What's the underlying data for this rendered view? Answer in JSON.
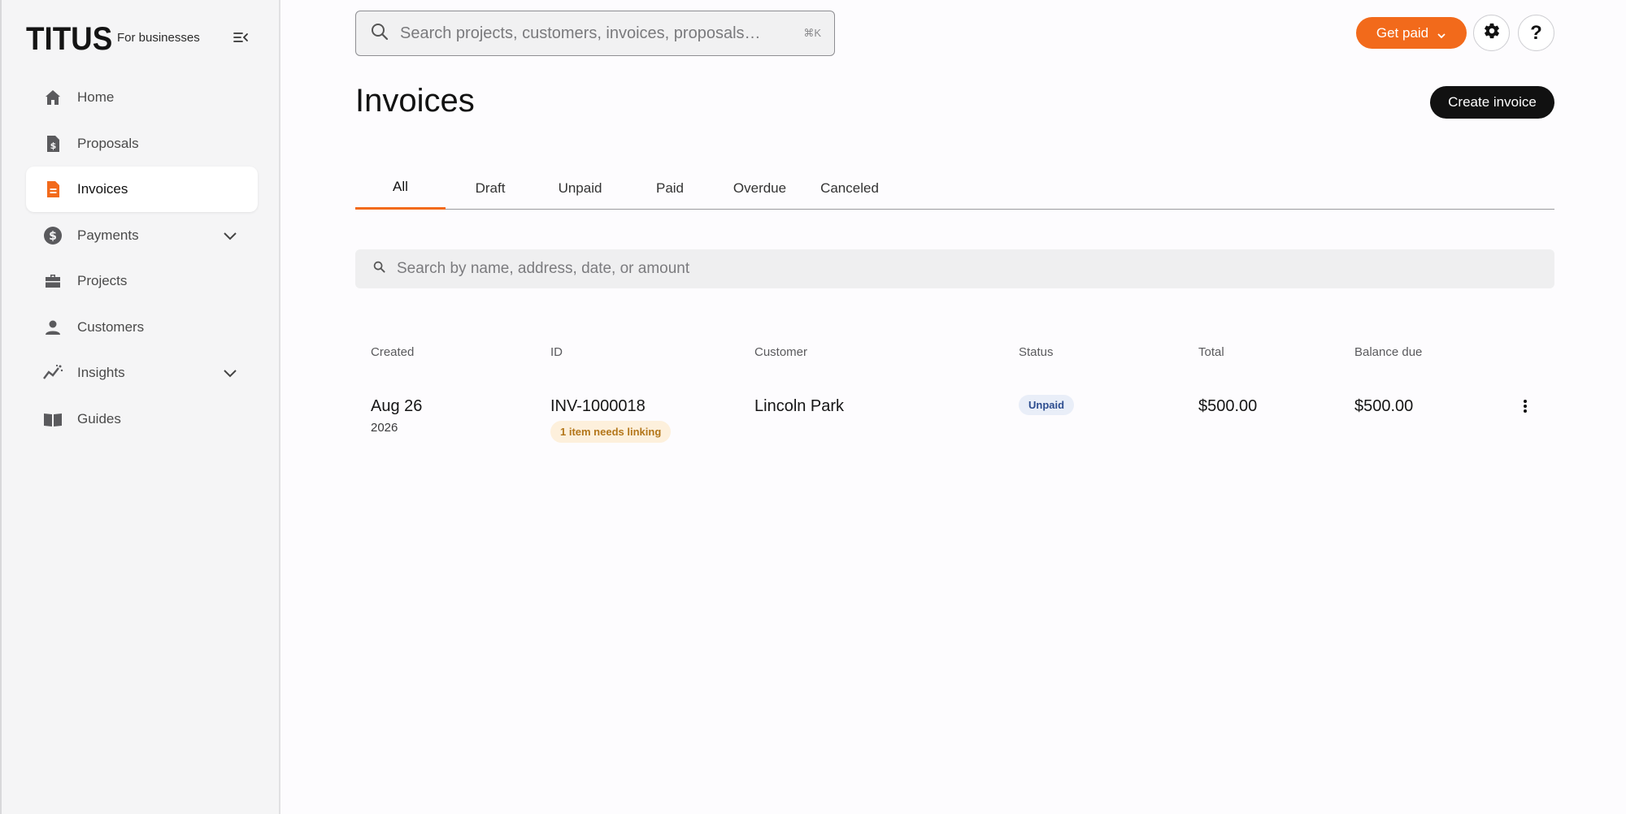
{
  "brand": {
    "logo": "TITUS",
    "tagline": "For businesses"
  },
  "sidebar": {
    "items": [
      {
        "label": "Home",
        "icon": "home-icon",
        "active": false,
        "expandable": false
      },
      {
        "label": "Proposals",
        "icon": "proposal-dollar-doc-icon",
        "active": false,
        "expandable": false
      },
      {
        "label": "Invoices",
        "icon": "invoice-doc-icon",
        "active": true,
        "expandable": false
      },
      {
        "label": "Payments",
        "icon": "dollar-circle-icon",
        "active": false,
        "expandable": true
      },
      {
        "label": "Projects",
        "icon": "briefcase-icon",
        "active": false,
        "expandable": false
      },
      {
        "label": "Customers",
        "icon": "person-icon",
        "active": false,
        "expandable": false
      },
      {
        "label": "Insights",
        "icon": "trend-line-icon",
        "active": false,
        "expandable": true
      },
      {
        "label": "Guides",
        "icon": "open-book-icon",
        "active": false,
        "expandable": false
      }
    ]
  },
  "topbar": {
    "search_placeholder": "Search projects, customers, invoices, proposals…",
    "shortcut": "⌘K",
    "get_paid_label": "Get paid",
    "help_label": "?"
  },
  "page": {
    "title": "Invoices",
    "create_label": "Create invoice"
  },
  "tabs": [
    {
      "label": "All",
      "active": true
    },
    {
      "label": "Draft",
      "active": false
    },
    {
      "label": "Unpaid",
      "active": false
    },
    {
      "label": "Paid",
      "active": false
    },
    {
      "label": "Overdue",
      "active": false
    },
    {
      "label": "Canceled",
      "active": false
    }
  ],
  "table": {
    "search_placeholder": "Search by name, address, date, or amount",
    "columns": [
      "Created",
      "ID",
      "Customer",
      "Status",
      "Total",
      "Balance due"
    ],
    "rows": [
      {
        "created_date": "Aug 26",
        "created_year": "2026",
        "id": "INV-1000018",
        "link_note": "1 item needs linking",
        "customer": "Lincoln Park",
        "status": "Unpaid",
        "total": "$500.00",
        "balance_due": "$500.00"
      }
    ]
  },
  "colors": {
    "accent": "#f26a1b",
    "sidebar_bg": "#f5f5f6",
    "primary_button": "#111111",
    "status_unpaid_bg": "#e9eef8",
    "link_badge_bg": "#fdf0dc"
  }
}
